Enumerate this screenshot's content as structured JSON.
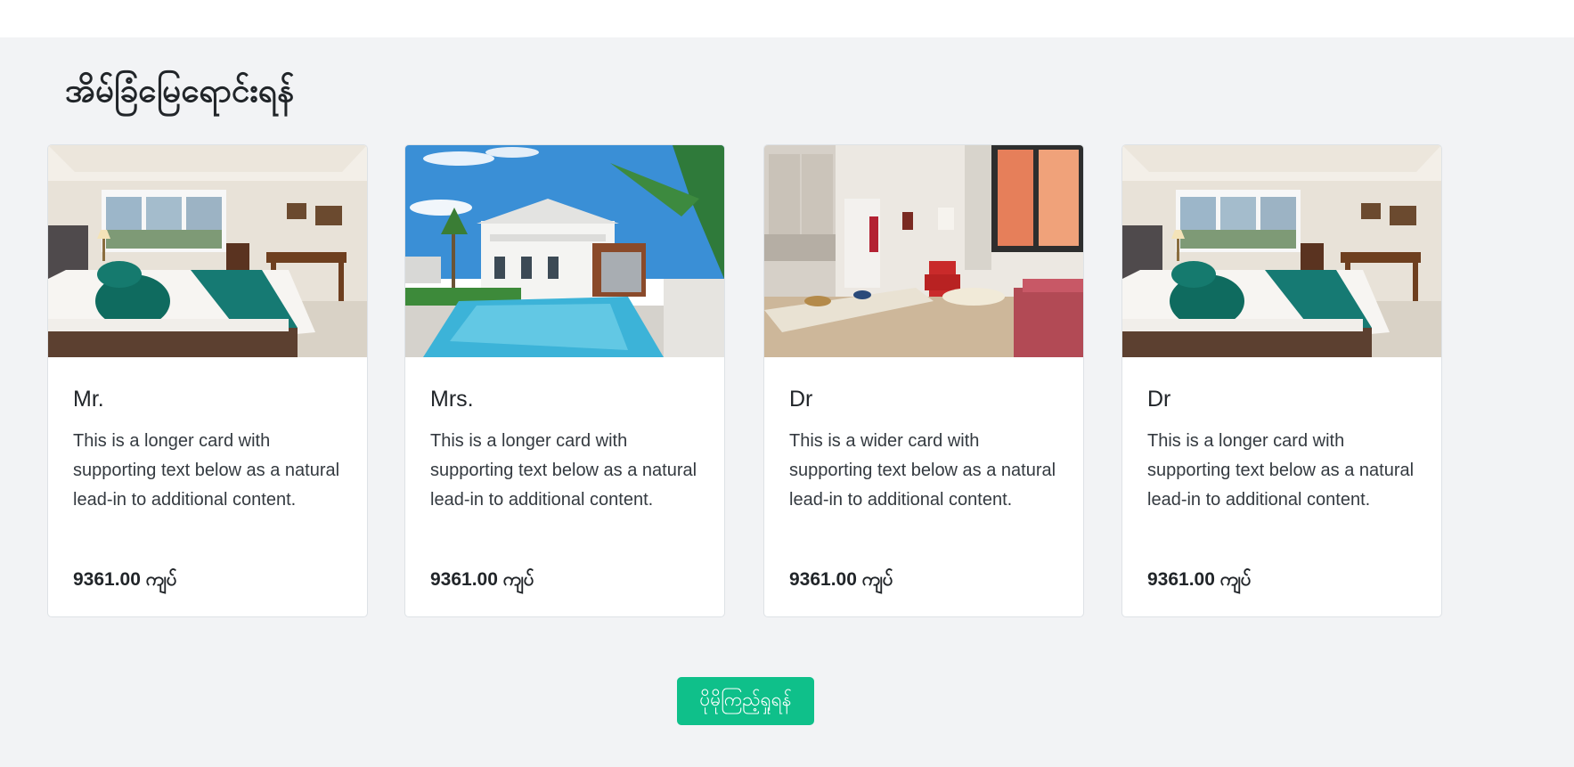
{
  "section": {
    "heading": "အိမ်ခြံမြေရောင်းရန်"
  },
  "cards": [
    {
      "title": "Mr.",
      "text": "This is a longer card with supporting text below as a natural lead-in to additional content.",
      "price": "9361.00 ကျပ်",
      "image": "bedroom-photo"
    },
    {
      "title": "Mrs.",
      "text": "This is a longer card with supporting text below as a natural lead-in to additional content.",
      "price": "9361.00 ကျပ်",
      "image": "house-pool-photo"
    },
    {
      "title": "Dr",
      "text": "This is a wider card with supporting text below as a natural lead-in to additional content.",
      "price": "9361.00 ကျပ်",
      "image": "living-room-photo"
    },
    {
      "title": "Dr",
      "text": "This is a longer card with supporting text below as a natural lead-in to additional content.",
      "price": "9361.00 ကျပ်",
      "image": "bedroom-photo"
    }
  ],
  "more_button": {
    "label": "ပိုမိုကြည့်ရှုရန်"
  },
  "colors": {
    "accent": "#0fc08a",
    "section_bg": "#f2f3f5"
  }
}
